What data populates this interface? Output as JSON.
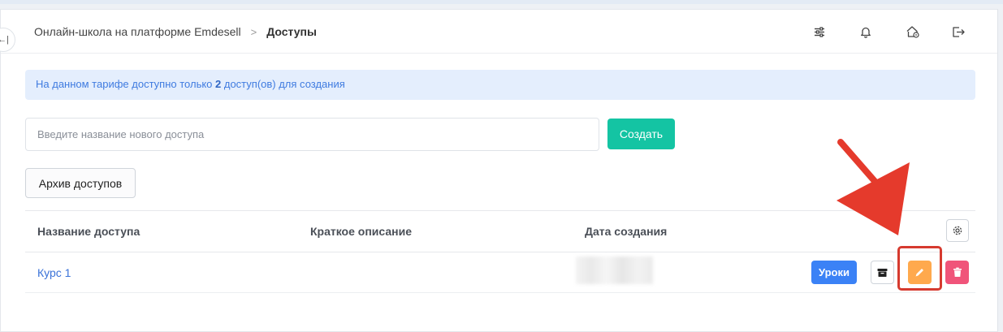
{
  "header": {
    "breadcrumb_root": "Онлайн-школа на платформе Emdesell",
    "breadcrumb_separator": ">",
    "breadcrumb_current": "Доступы",
    "collapse_icon": "←|",
    "icons": [
      "filter-sliders-icon",
      "bell-icon",
      "home-settings-icon",
      "logout-icon"
    ]
  },
  "alert": {
    "prefix": "На данном тарифе доступно только ",
    "count": "2",
    "suffix": " доступ(ов) для создания"
  },
  "new_access": {
    "placeholder": "Введите название нового доступа",
    "value": "",
    "create_label": "Создать"
  },
  "archive_button_label": "Архив доступов",
  "table": {
    "columns": [
      "Название доступа",
      "Краткое описание",
      "Дата создания"
    ],
    "rows": [
      {
        "name": "Курс 1",
        "description": "",
        "lessons_label": "Уроки"
      }
    ]
  },
  "colors": {
    "accent_green": "#14c4a3",
    "primary_blue": "#3b82f6",
    "edit_orange": "#ffa94d",
    "delete_pink": "#f0547a",
    "annotation_red": "#d63a2f",
    "alert_bg": "#e4eefd"
  }
}
